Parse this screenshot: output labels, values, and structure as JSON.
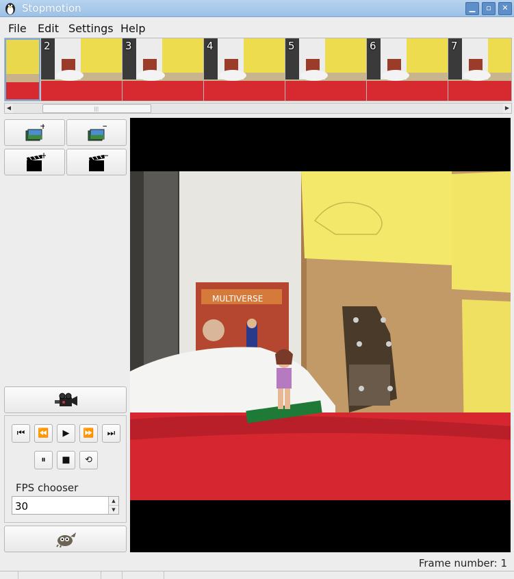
{
  "window": {
    "title": "Stopmotion"
  },
  "menu": [
    {
      "label": "File"
    },
    {
      "label": "Edit"
    },
    {
      "label": "Settings"
    },
    {
      "label": "Help"
    }
  ],
  "timeline": {
    "frames": [
      "",
      "2",
      "3",
      "4",
      "5",
      "6",
      "7"
    ]
  },
  "controls": {
    "fps_label": "FPS chooser",
    "fps_value": "30"
  },
  "status": {
    "frame_number": "Frame number: 1"
  },
  "icons": {
    "add_frames": "add-frames-icon",
    "remove_frames": "remove-frames-icon",
    "add_scene": "add-scene-icon",
    "remove_scene": "remove-scene-icon",
    "camera": "video-camera-icon",
    "gimp": "gimp-icon"
  }
}
